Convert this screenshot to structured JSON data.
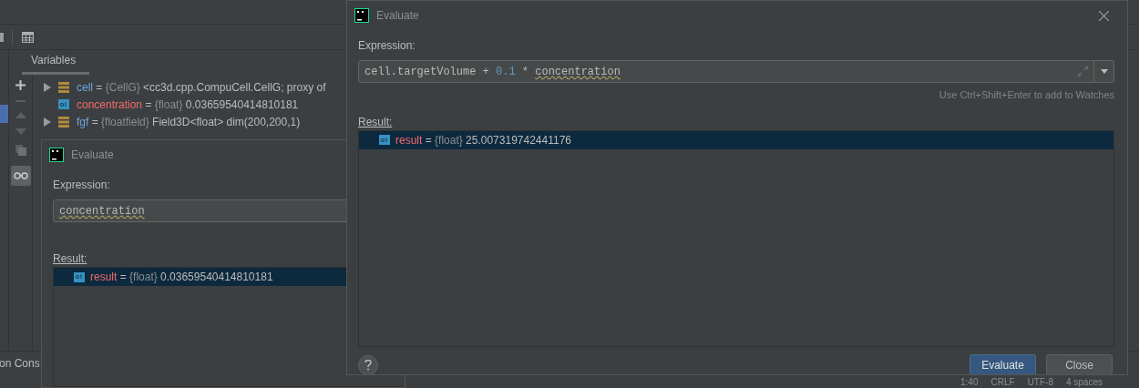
{
  "ide": {
    "variables_tab": "Variables",
    "variables": [
      {
        "name": "cell",
        "sep": "=",
        "type": "{CellG}",
        "value": "<cc3d.cpp.CompuCell.CellG; proxy of",
        "kind": "object",
        "expandable": true,
        "changed": false
      },
      {
        "name": "concentration",
        "sep": "=",
        "type": "{float}",
        "value": "0.03659540414810181",
        "kind": "number",
        "expandable": false,
        "changed": true
      },
      {
        "name": "fgf",
        "sep": "=",
        "type": "{floatfield}",
        "value": "Field3D<float> dim(200,200,1)",
        "kind": "object",
        "expandable": true,
        "changed": false
      }
    ],
    "bottom_tab": "on Cons",
    "status_bar": [
      "1:40",
      "CRLF",
      "UTF-8",
      "4 spaces"
    ]
  },
  "dialogs": [
    {
      "title": "Evaluate",
      "expression_label": "Expression:",
      "expression": [
        {
          "text": "concentration",
          "kind": "warned"
        }
      ],
      "result_label": "Result:",
      "results": [
        {
          "name": "result",
          "sep": "=",
          "type": "{float}",
          "value": "0.03659540414810181",
          "selected": true
        }
      ]
    },
    {
      "title": "Evaluate",
      "expression_label": "Expression:",
      "expression": [
        {
          "text": "cell.targetVolume + ",
          "kind": "text"
        },
        {
          "text": "0.1",
          "kind": "number"
        },
        {
          "text": " * ",
          "kind": "text"
        },
        {
          "text": "concentration",
          "kind": "warned"
        }
      ],
      "hint": "Use Ctrl+Shift+Enter to add to Watches",
      "result_label": "Result:",
      "results": [
        {
          "name": "result",
          "sep": "=",
          "type": "{float}",
          "value": "25.007319742441176",
          "selected": true
        }
      ],
      "buttons": [
        {
          "label": "Evaluate",
          "primary": true
        },
        {
          "label": "Close",
          "primary": false
        }
      ]
    }
  ]
}
